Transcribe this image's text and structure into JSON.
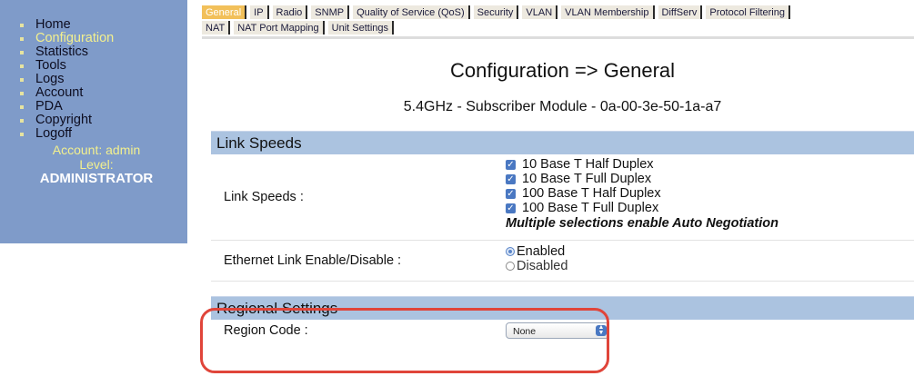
{
  "sidebar": {
    "items": [
      {
        "label": "Home",
        "active": false
      },
      {
        "label": "Configuration",
        "active": true
      },
      {
        "label": "Statistics",
        "active": false
      },
      {
        "label": "Tools",
        "active": false
      },
      {
        "label": "Logs",
        "active": false
      },
      {
        "label": "Account",
        "active": false
      },
      {
        "label": "PDA",
        "active": false
      },
      {
        "label": "Copyright",
        "active": false
      },
      {
        "label": "Logoff",
        "active": false
      }
    ],
    "account_text": "Account: admin",
    "level_label": "Level:",
    "level_value": "ADMINISTRATOR"
  },
  "tabs": {
    "row1": [
      "General",
      "IP",
      "Radio",
      "SNMP",
      "Quality of Service (QoS)",
      "Security",
      "VLAN",
      "VLAN Membership",
      "DiffServ",
      "Protocol Filtering"
    ],
    "row2": [
      "NAT",
      "NAT Port Mapping",
      "Unit Settings"
    ],
    "active": "General"
  },
  "main": {
    "title": "Configuration => General",
    "device": "5.4GHz - Subscriber Module - 0a-00-3e-50-1a-a7"
  },
  "link_speeds": {
    "heading": "Link Speeds",
    "label": "Link Speeds :",
    "options": [
      {
        "label": "10 Base T Half Duplex",
        "checked": true
      },
      {
        "label": "10 Base T Full Duplex",
        "checked": true
      },
      {
        "label": "100 Base T Half Duplex",
        "checked": true
      },
      {
        "label": "100 Base T Full Duplex",
        "checked": true
      }
    ],
    "note": "Multiple selections enable Auto Negotiation"
  },
  "ethernet": {
    "label": "Ethernet Link Enable/Disable :",
    "options": [
      {
        "label": "Enabled",
        "selected": true
      },
      {
        "label": "Disabled",
        "selected": false
      }
    ]
  },
  "regional": {
    "heading": "Regional Settings",
    "label": "Region Code :",
    "value": "None"
  },
  "colors": {
    "sidebar_bg": "#7f9bc9",
    "active_tab": "#f2c05a",
    "section_head": "#abc3e0",
    "highlight": "#e0453a"
  }
}
